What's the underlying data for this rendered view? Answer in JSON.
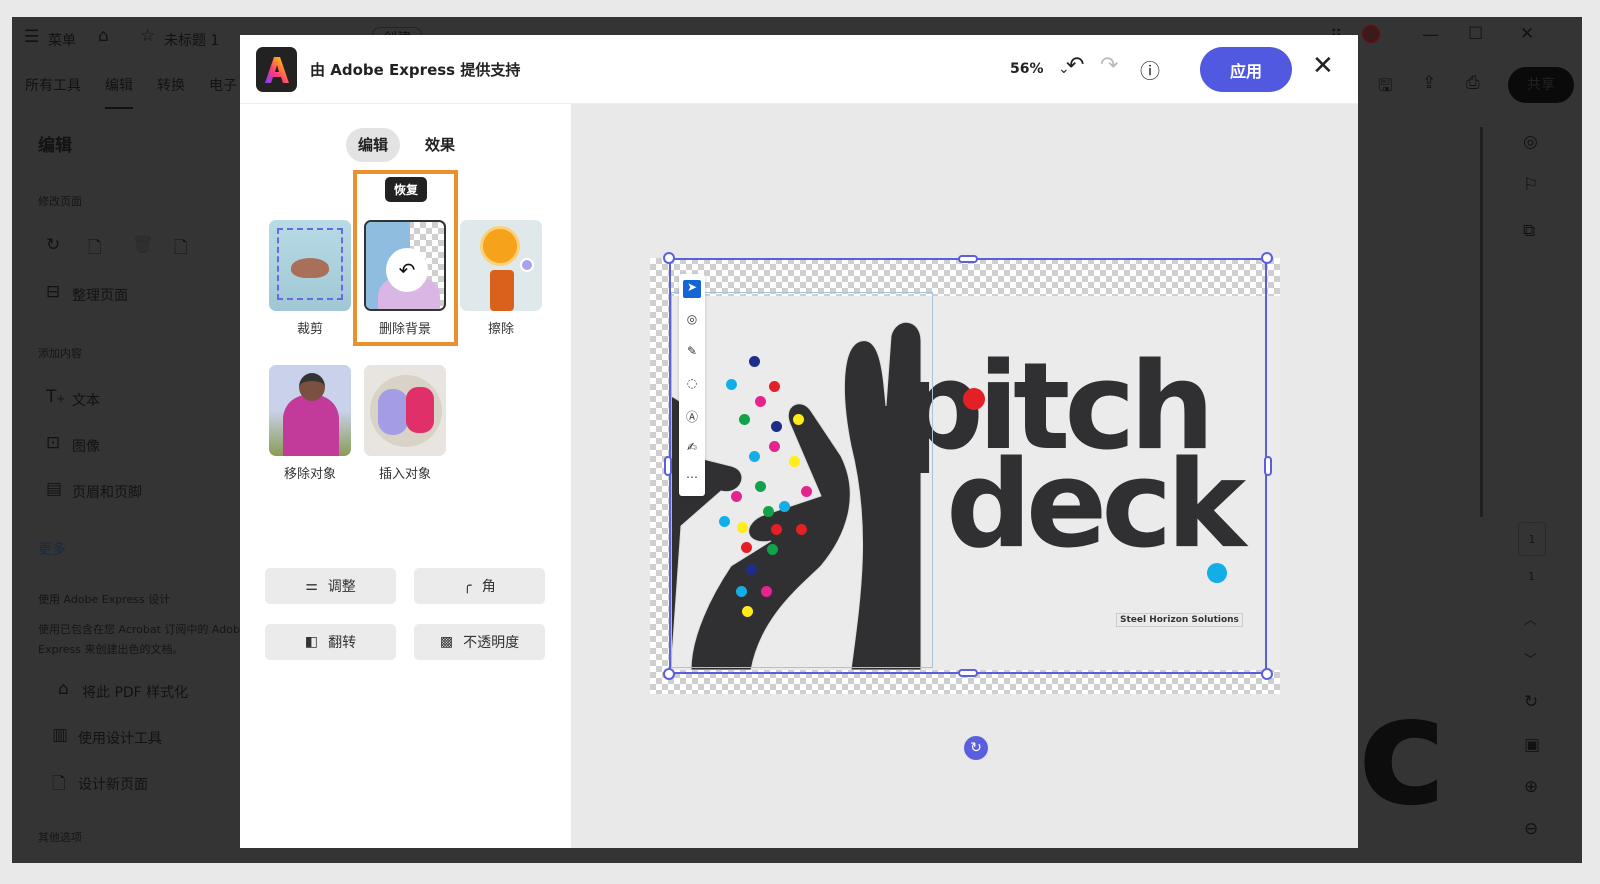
{
  "app": {
    "menu_label": "菜单",
    "doc_title": "未标题 1",
    "create_label": "创建",
    "tabs": [
      "所有工具",
      "编辑",
      "转换",
      "电子"
    ],
    "share_label": "共享",
    "sidebar": {
      "title": "编辑",
      "section_modify": "修改页面",
      "organize": "整理页面",
      "section_add": "添加内容",
      "text": "文本",
      "image": "图像",
      "header_footer": "页眉和页脚",
      "more": "更多",
      "express_title": "使用 Adobe Express 设计",
      "express_desc_1": "使用已包含在您 Acrobat 订阅中的 Adobe",
      "express_desc_2": "Express 来创建出色的文档。",
      "style_pdf": "将此 PDF 样式化",
      "design_tools": "使用设计工具",
      "new_page": "设计新页面",
      "other": "其他选项"
    },
    "page_current": "1",
    "page_total": "1"
  },
  "modal": {
    "title": "由 Adobe Express 提供支持",
    "zoom": "56%",
    "apply_label": "应用",
    "tabs": {
      "edit": "编辑",
      "effects": "效果"
    },
    "tooltip": "恢复",
    "tools": [
      {
        "label": "裁剪"
      },
      {
        "label": "删除背景"
      },
      {
        "label": "擦除"
      },
      {
        "label": "移除对象"
      },
      {
        "label": "插入对象"
      }
    ],
    "actions": {
      "adjust": "调整",
      "corner": "角",
      "flip": "翻转",
      "opacity": "不透明度"
    },
    "canvas": {
      "line1": "pitch",
      "line2": "deck",
      "company": "Steel Horizon Solutions"
    }
  },
  "colors": {
    "accent": "#5159e0",
    "highlight": "#e8912d",
    "dot_red": "#e51f26",
    "dot_blue": "#13aee8"
  }
}
